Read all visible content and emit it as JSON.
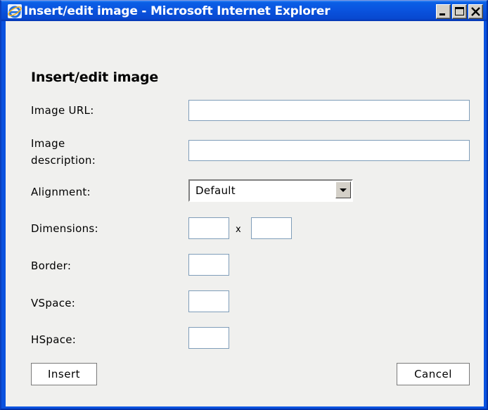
{
  "window": {
    "title": "Insert/edit image - Microsoft Internet Explorer",
    "icon": "internet-explorer-icon",
    "controls": [
      "minimize-icon",
      "maximize-icon",
      "close-icon"
    ]
  },
  "form": {
    "heading": "Insert/edit image",
    "image_url": {
      "label": "Image URL:",
      "value": ""
    },
    "description": {
      "label_line1": "Image",
      "label_line2": "description:",
      "value": ""
    },
    "alignment": {
      "label": "Alignment:",
      "value": "Default"
    },
    "dimensions": {
      "label": "Dimensions:",
      "width": "",
      "separator": "x",
      "height": ""
    },
    "border": {
      "label": "Border:",
      "value": ""
    },
    "vspace": {
      "label": "VSpace:",
      "value": ""
    },
    "hspace": {
      "label": "HSpace:",
      "value": ""
    }
  },
  "buttons": {
    "insert": "Insert",
    "cancel": "Cancel"
  },
  "colors": {
    "titlebar": "#0a55e0",
    "dialog_background": "#f0f0ee",
    "field_border": "#7f9db9"
  }
}
